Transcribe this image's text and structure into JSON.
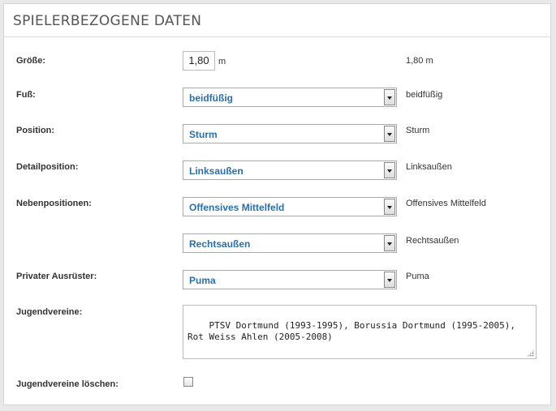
{
  "section": {
    "title": "SPIELERBEZOGENE DATEN"
  },
  "fields": {
    "groesse": {
      "label": "Größe:",
      "value": "1,80",
      "unit": "m",
      "echo": "1,80 m"
    },
    "fuss": {
      "label": "Fuß:",
      "value": "beidfüßig",
      "echo": "beidfüßig"
    },
    "position": {
      "label": "Position:",
      "value": "Sturm",
      "echo": "Sturm"
    },
    "detailposition": {
      "label": "Detailposition:",
      "value": "Linksaußen",
      "echo": "Linksaußen"
    },
    "nebenpositionen": {
      "label": "Nebenpositionen:",
      "first_value": "Offensives Mittelfeld",
      "first_echo": "Offensives Mittelfeld",
      "second_value": "Rechtsaußen",
      "second_echo": "Rechtsaußen"
    },
    "ausruester": {
      "label": "Privater Ausrüster:",
      "value": "Puma",
      "echo": "Puma"
    },
    "jugendvereine": {
      "label": "Jugendvereine:",
      "value": "PTSV Dortmund (1993-1995), Borussia Dortmund (1995-2005),\nRot Weiss Ahlen (2005-2008)"
    },
    "jugendvereine_loeschen": {
      "label": "Jugendvereine löschen:",
      "checked": false
    }
  },
  "colors": {
    "select_text": "#2a6fa8",
    "background": "#e9e9e9"
  }
}
